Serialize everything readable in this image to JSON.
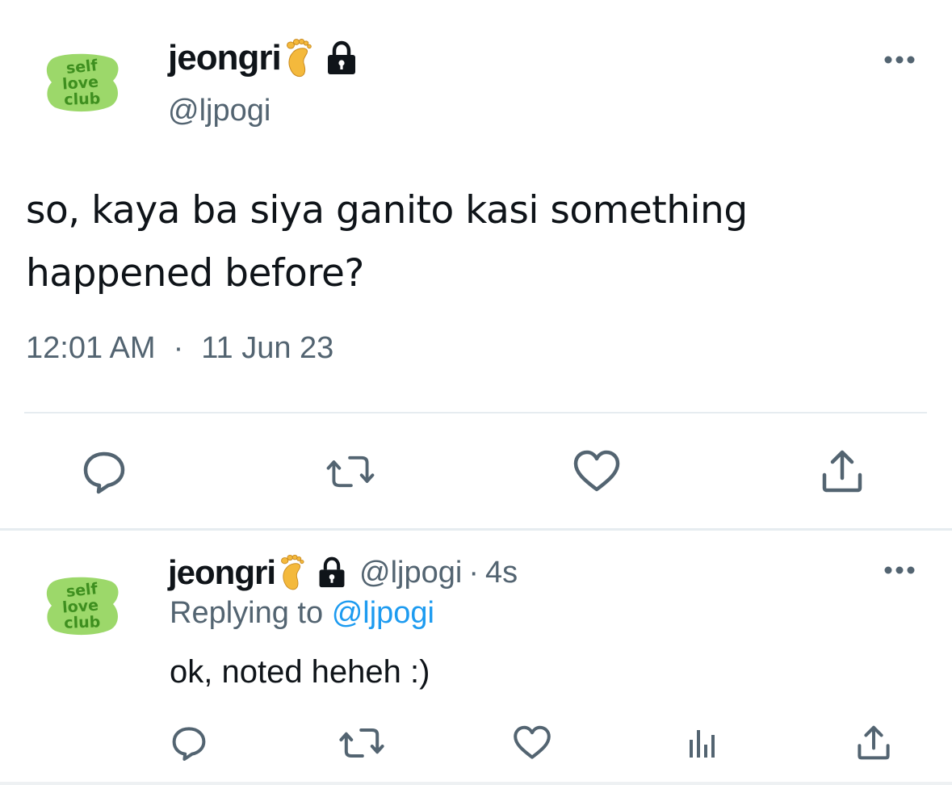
{
  "tweet": {
    "avatar_text": [
      "self",
      "love",
      "club"
    ],
    "display_name": "jeongri",
    "handle": "@ljpogi",
    "text_line1": "so, kaya ba siya ganito kasi something",
    "text_line2": "happened before?",
    "time": "12:01 AM",
    "separator": "·",
    "date": "11 Jun 23",
    "icons": [
      "foot-emoji",
      "lock-icon",
      "more-icon",
      "reply-icon",
      "retweet-icon",
      "like-icon",
      "share-icon"
    ]
  },
  "reply": {
    "avatar_text": [
      "self",
      "love",
      "club"
    ],
    "display_name": "jeongri",
    "handle": "@ljpogi",
    "dot": "·",
    "time": "4s",
    "replying_prefix": "Replying to",
    "replying_mention": "@ljpogi",
    "text": "ok, noted heheh :)",
    "icons": [
      "foot-emoji",
      "lock-icon",
      "more-icon",
      "reply-icon",
      "retweet-icon",
      "like-icon",
      "analytics-icon",
      "share-icon"
    ]
  },
  "colors": {
    "text": "#0f1419",
    "secondary": "#536471",
    "link": "#1d9bf0",
    "avatar_fill": "#9cd86a",
    "avatar_text": "#3e8f1f",
    "divider": "#e6ecf0"
  }
}
